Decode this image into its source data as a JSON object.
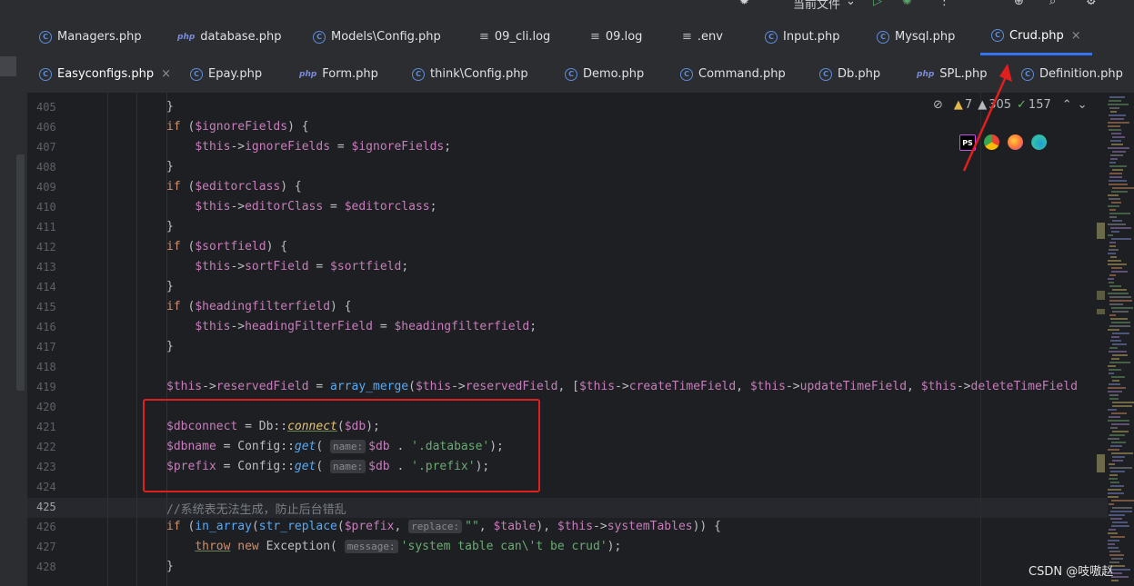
{
  "topbar": {
    "file_scope": "当前文件"
  },
  "tabs_row1": [
    {
      "label": "Managers.php",
      "icon": "class-icon"
    },
    {
      "label": "database.php",
      "icon": "php-icon"
    },
    {
      "label": "Models\\Config.php",
      "icon": "class-icon"
    },
    {
      "label": "09_cli.log",
      "icon": "log-icon"
    },
    {
      "label": "09.log",
      "icon": "log-icon"
    },
    {
      "label": ".env",
      "icon": "log-icon"
    },
    {
      "label": "Input.php",
      "icon": "class-icon"
    },
    {
      "label": "Mysql.php",
      "icon": "class-icon"
    },
    {
      "label": "Crud.php",
      "icon": "class-icon",
      "active": true
    }
  ],
  "tabs_row2": [
    {
      "label": "Easyconfigs.php",
      "icon": "class-icon"
    },
    {
      "label": "Epay.php",
      "icon": "class-icon"
    },
    {
      "label": "Form.php",
      "icon": "php-icon"
    },
    {
      "label": "think\\Config.php",
      "icon": "class-icon"
    },
    {
      "label": "Demo.php",
      "icon": "class-icon"
    },
    {
      "label": "Command.php",
      "icon": "class-icon"
    },
    {
      "label": "Db.php",
      "icon": "class-icon"
    },
    {
      "label": "SPL.php",
      "icon": "php-icon"
    },
    {
      "label": "Definition.php",
      "icon": "class-icon"
    }
  ],
  "inspection": {
    "warnings": "7",
    "weak_warnings": "305",
    "typos": "157"
  },
  "line_numbers": [
    "405",
    "406",
    "407",
    "408",
    "409",
    "410",
    "411",
    "412",
    "413",
    "414",
    "415",
    "416",
    "417",
    "418",
    "419",
    "420",
    "421",
    "422",
    "423",
    "424",
    "425",
    "426",
    "427",
    "428"
  ],
  "hints": {
    "name": "name:",
    "replace": "replace:",
    "message": "message:"
  },
  "colors": {
    "highlight_box": "#e01f1f",
    "active_tab": "#3574f0"
  },
  "watermark": "CSDN @吱嗷赵"
}
